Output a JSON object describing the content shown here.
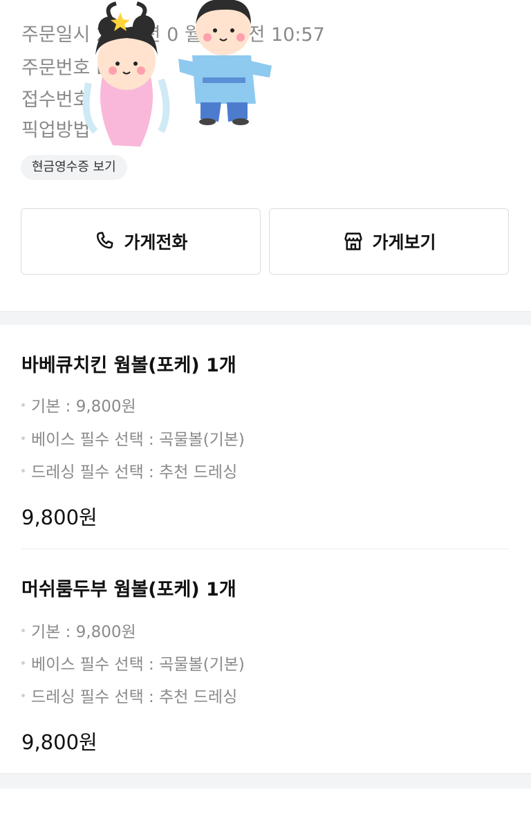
{
  "order_info": {
    "rows": [
      "주문일시  2023년 0  월  일 오전 10:57",
      "주문번호  B1  00",
      "접수번호",
      "픽업방법"
    ],
    "receipt_button": "현금영수증 보기"
  },
  "actions": {
    "call_store": "가게전화",
    "view_store": "가게보기"
  },
  "items": [
    {
      "title": "바베큐치킨 웜볼(포케) 1개",
      "options": [
        "기본 : 9,800원",
        "베이스 필수 선택 : 곡물볼(기본)",
        "드레싱 필수 선택 : 추천 드레싱"
      ],
      "price": "9,800원"
    },
    {
      "title": "머쉬룸두부 웜볼(포케) 1개",
      "options": [
        "기본 : 9,800원",
        "베이스 필수 선택 : 곡물볼(기본)",
        "드레싱 필수 선택 : 추천 드레싱"
      ],
      "price": "9,800원"
    }
  ],
  "icons": {
    "call": "phone-icon",
    "store": "store-icon"
  }
}
